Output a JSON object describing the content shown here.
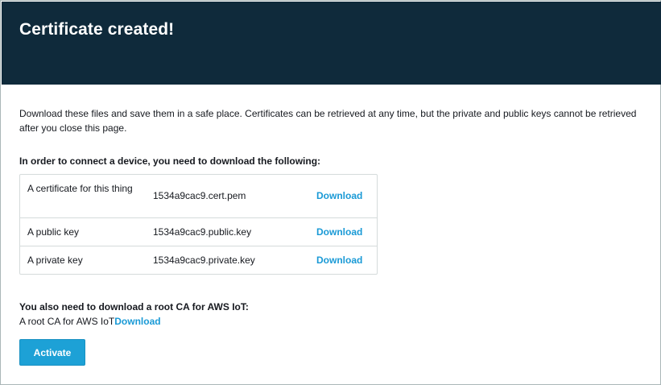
{
  "header": {
    "title": "Certificate created!"
  },
  "intro": "Download these files and save them in a safe place. Certificates can be retrieved at any time, but the private and public keys cannot be retrieved after you close this page.",
  "files_heading": "In order to connect a device, you need to download the following:",
  "files": [
    {
      "description": "A certificate for this thing",
      "filename": "1534a9cac9.cert.pem",
      "action": "Download"
    },
    {
      "description": "A public key",
      "filename": "1534a9cac9.public.key",
      "action": "Download"
    },
    {
      "description": "A private key",
      "filename": "1534a9cac9.private.key",
      "action": "Download"
    }
  ],
  "root_ca": {
    "heading": "You also need to download a root CA for AWS IoT:",
    "label": "A root CA for AWS IoT",
    "action": "Download"
  },
  "activate_label": "Activate",
  "colors": {
    "header_bg": "#0f2a3b",
    "link": "#1a9ad6",
    "button_bg": "#1da1d6"
  }
}
